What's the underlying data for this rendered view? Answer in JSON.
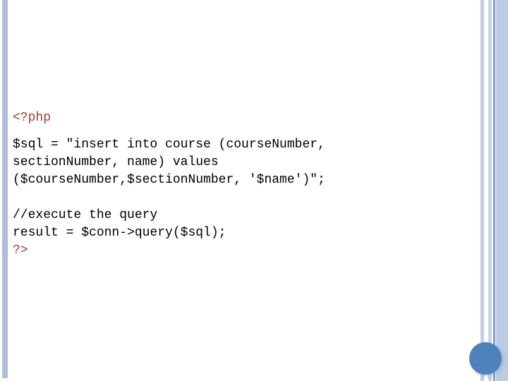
{
  "slide": {
    "background_color": "#ffffff",
    "accent_color": "#4f81bd",
    "bar_color": "#aebedb",
    "php_tag_color": "#9e3b3b",
    "code_color": "#000000"
  },
  "code": {
    "open_tag": "<?php",
    "close_tag": "?>",
    "statement_sql": "$sql = \"insert into course (courseNumber, sectionNumber, name) values ($courseNumber,$sectionNumber, '$name')\";",
    "comment_execute": "//execute the query",
    "statement_query": "result = $conn->query($sql);"
  },
  "decorations": {
    "left_bar": "left-vertical-bar",
    "right_bars": [
      "right-bar-1",
      "right-bar-2",
      "right-bar-3",
      "right-bar-4"
    ],
    "circle": "bottom-right-circle"
  }
}
